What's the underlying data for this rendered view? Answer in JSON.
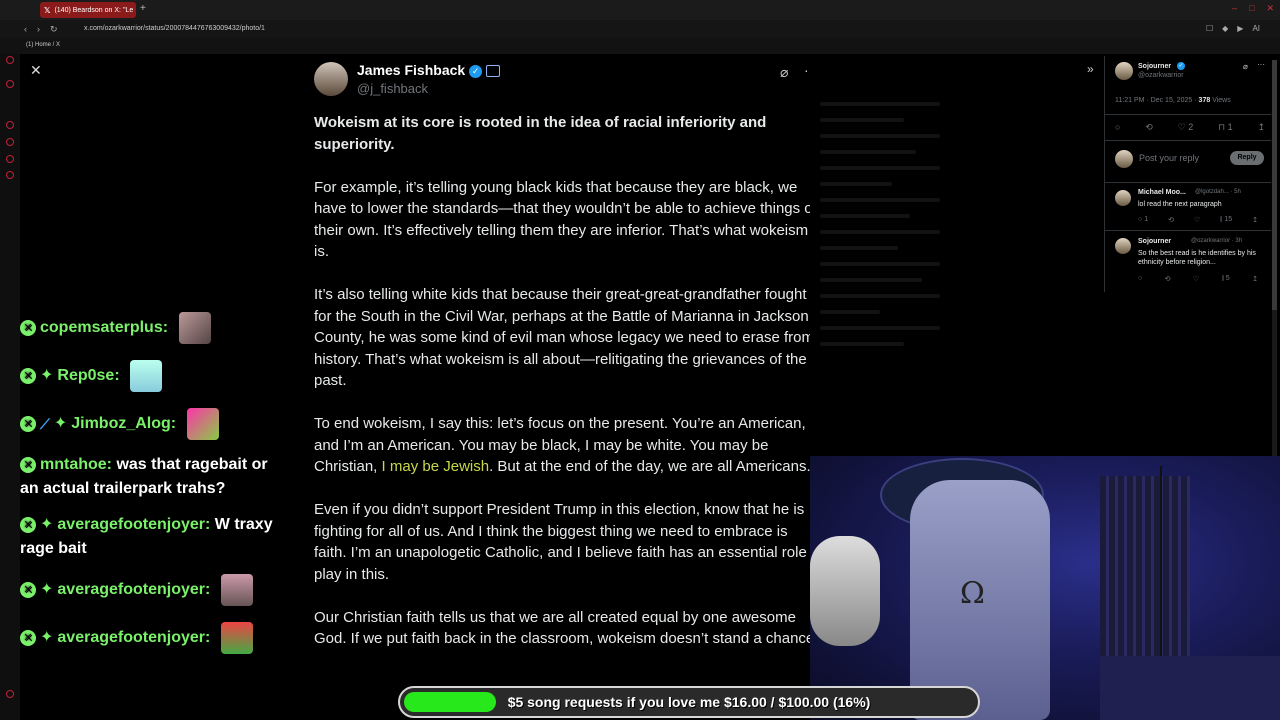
{
  "browser": {
    "tab_title": "(140) Beardson on X: \"Le",
    "url": "x.com/ozarkwarrior/status/2000784476763009432/photo/1",
    "bookmark": "(1) Home / X",
    "new_tab": "+",
    "ai_label": "AI"
  },
  "chat": {
    "messages": [
      {
        "user": "copemsaterplus:",
        "text": "",
        "badges": [
          "x"
        ]
      },
      {
        "user": "Rep0se:",
        "text": "",
        "badges": [
          "x",
          "star"
        ]
      },
      {
        "user": "Jimboz_Alog:",
        "text": "",
        "badges": [
          "x",
          "sword",
          "star"
        ]
      },
      {
        "user": "mntahoe:",
        "text": "was that ragebait or an actual trailerpark trahs?",
        "badges": [
          "x"
        ]
      },
      {
        "user": "averagefootenjoyer:",
        "text": "W traxy rage bait",
        "badges": [
          "x",
          "star"
        ]
      },
      {
        "user": "averagefootenjoyer:",
        "text": "",
        "badges": [
          "x",
          "star"
        ]
      },
      {
        "user": "averagefootenjoyer:",
        "text": "",
        "badges": [
          "x",
          "star"
        ]
      }
    ]
  },
  "tweet": {
    "author_name": "James Fishback",
    "author_handle": "@j_fishback",
    "paragraphs": {
      "p1": "Wokeism at its core is rooted in the idea of racial inferiority and superiority.",
      "p2": "For example, it’s telling young black kids that because they are black, we have to lower the standards—that they wouldn’t be able to achieve things on their own. It’s effectively telling them they are inferior. That’s what wokeism is.",
      "p3": "It’s also telling white kids that because their great-great-grandfather fought for the South in the Civil War, perhaps at the Battle of Marianna in Jackson County, he was some kind of evil man whose legacy we need to erase from history. That’s what wokeism is all about—relitigating the grievances of the past.",
      "p4a": "To end wokeism, I say this: let’s focus on the present. You’re an American, and I’m an American. You may be black, I may be white. You may be Christian,",
      "p4hl": "I may be Jewish",
      "p4b": ". But at the end of the day, we are all Americans.",
      "p5": "Even if you didn’t support President Trump in this election, know that he is fighting for all of us. And I think the biggest thing we need to embrace is faith. I’m an unapologetic Catholic, and I believe faith has an essential role to play in this.",
      "p6": "Our Christian faith tells us that we are all created equal by one awesome God. If we put faith back in the classroom, wokeism doesn’t stand a chance.\""
    }
  },
  "side": {
    "author_name": "Sojourner",
    "author_handle": "@ozarkwarrior",
    "timestamp": "11:21 PM · Dec 15, 2025 ·",
    "views_count": "378",
    "views_label": "Views",
    "likes": "2",
    "bookmarks": "1",
    "reply_placeholder": "Post your reply",
    "reply_button": "Reply",
    "comments": [
      {
        "name": "Michael Moo...",
        "handle": "@lgotzdah... · 5h",
        "text": "lol read the next paragraph",
        "replies": "1",
        "likes": "15"
      },
      {
        "name": "Sojourner",
        "handle": "@ozarkwarrior · 3h",
        "text": "So the best read is he identifies by his ethnicity before religion...",
        "replies": "",
        "likes": "5"
      }
    ]
  },
  "goal": {
    "text": "$5 song requests if you love me $16.00 / $100.00 (16%)",
    "progress": 0.16
  },
  "colors": {
    "accent_green": "#7bf06a",
    "goal_fill": "#27e81b",
    "verified_blue": "#1d9bf0",
    "highlight": "#c8d84a"
  }
}
